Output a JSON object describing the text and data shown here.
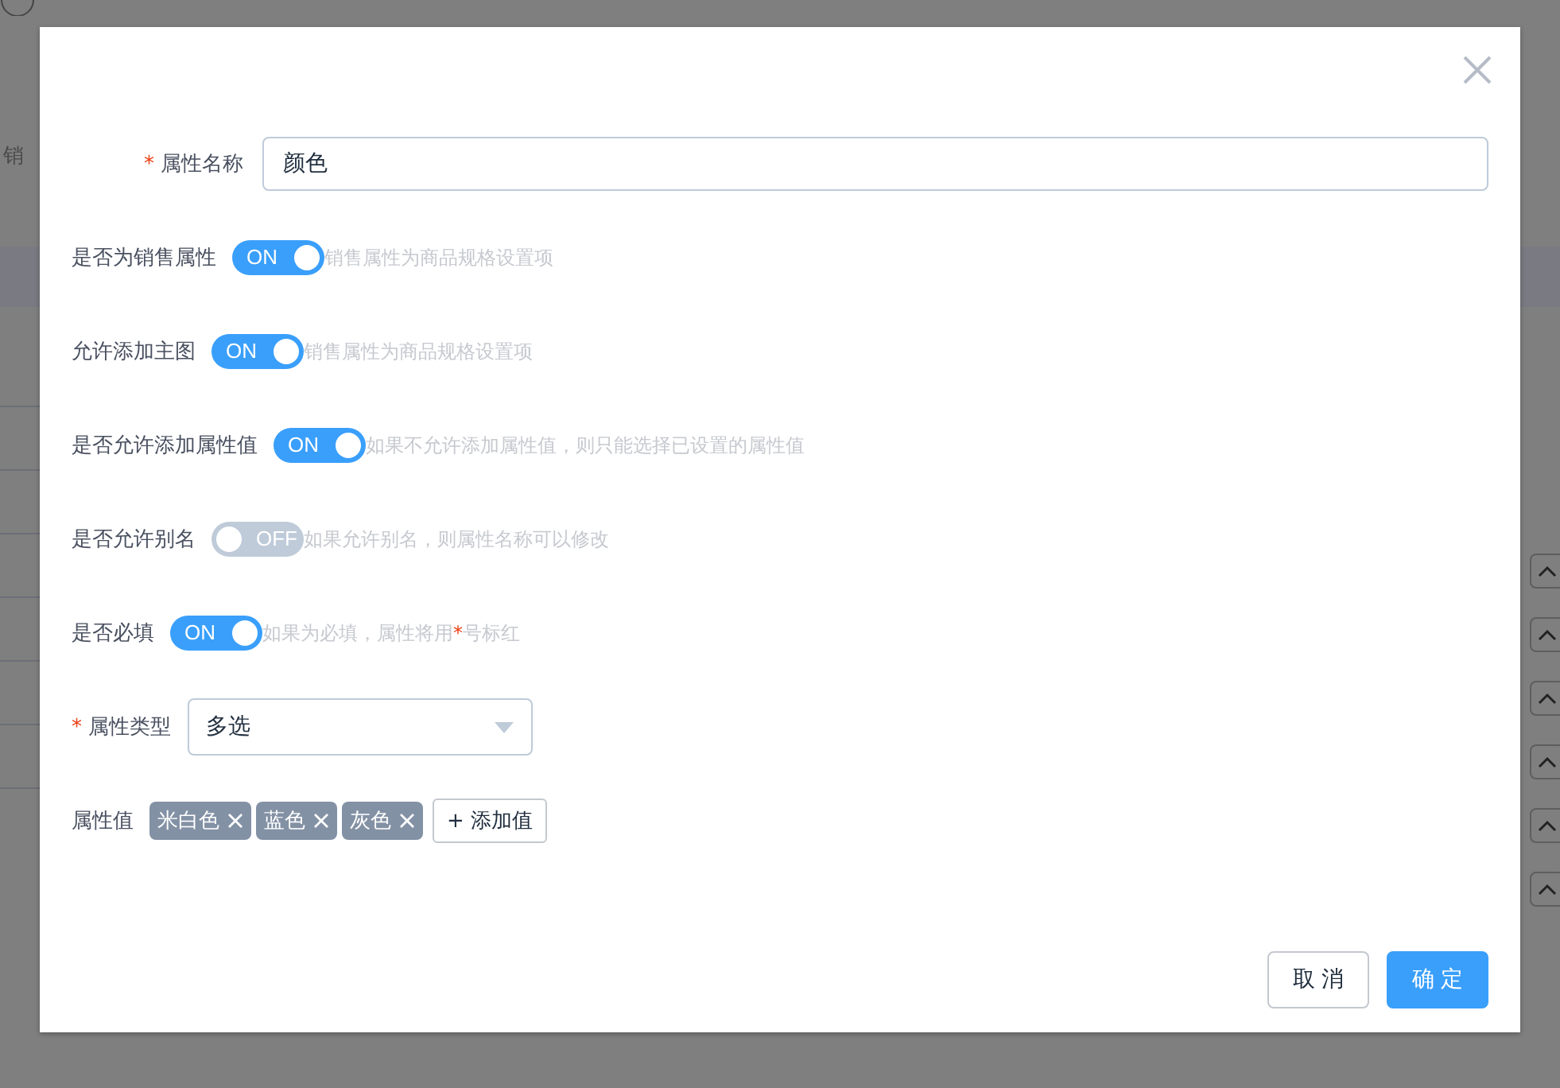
{
  "background": {
    "text_fragment": "销"
  },
  "dialog": {
    "fields": [
      {
        "kind": "text",
        "label": "属性名称",
        "required": true,
        "value": "颜色"
      },
      {
        "kind": "switch",
        "label": "是否为销售属性",
        "required": false,
        "on": true,
        "switch_text": "ON",
        "hint": [
          {
            "text": "销售属性为商品规格设置项",
            "highlight": false
          }
        ]
      },
      {
        "kind": "switch",
        "label": "允许添加主图",
        "required": false,
        "on": true,
        "switch_text": "ON",
        "hint": [
          {
            "text": "销售属性为商品规格设置项",
            "highlight": false
          }
        ]
      },
      {
        "kind": "switch",
        "label": "是否允许添加属性值",
        "required": false,
        "on": true,
        "switch_text": "ON",
        "hint": [
          {
            "text": "如果不允许添加属性值，则只能选择已设置的属性值",
            "highlight": false
          }
        ]
      },
      {
        "kind": "switch",
        "label": "是否允许别名",
        "required": false,
        "on": false,
        "switch_text": "OFF",
        "hint": [
          {
            "text": "如果允许别名，则属性名称可以修改",
            "highlight": false
          }
        ]
      },
      {
        "kind": "switch",
        "label": "是否必填",
        "required": false,
        "on": true,
        "switch_text": "ON",
        "hint": [
          {
            "text": "如果为必填，属性将用",
            "highlight": false
          },
          {
            "text": "*",
            "highlight": true
          },
          {
            "text": "号标红",
            "highlight": false
          }
        ]
      },
      {
        "kind": "select",
        "label": "属性类型",
        "required": true,
        "value": "多选"
      },
      {
        "kind": "tags",
        "label": "属性值",
        "required": false,
        "tags": [
          "米白色",
          "蓝色",
          "灰色"
        ],
        "add_button": "+ 添加值"
      }
    ],
    "buttons": [
      {
        "label": "取 消",
        "primary": false
      },
      {
        "label": "确 定",
        "primary": true
      }
    ]
  }
}
